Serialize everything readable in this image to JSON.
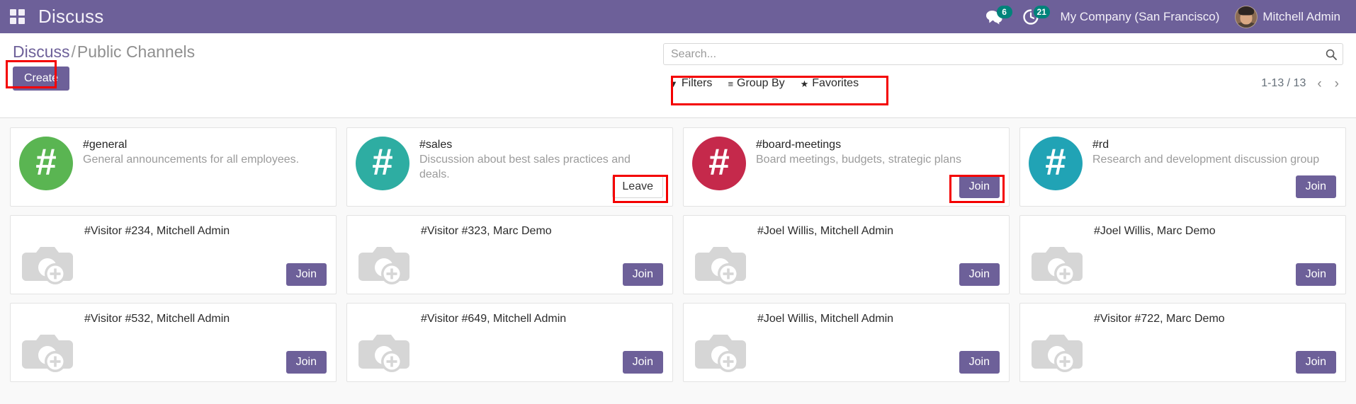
{
  "navbar": {
    "apps_icon": "apps-grid-icon",
    "app_title": "Discuss",
    "messages_icon": "messages-icon",
    "messages_count": "6",
    "activities_icon": "clock-activity-icon",
    "activities_count": "21",
    "company": "My Company (San Francisco)",
    "user_name": "Mitchell Admin",
    "avatar_icon": "user-avatar",
    "brand_color": "#6d6099",
    "badge_color": "#00837a"
  },
  "control_panel": {
    "breadcrumb_root": "Discuss",
    "breadcrumb_separator": "/",
    "breadcrumb_current": "Public Channels",
    "create_label": "Create",
    "search_placeholder": "Search...",
    "search_value": "",
    "search_icon": "search-icon",
    "filters": [
      {
        "label": "Filters",
        "icon": "filter-funnel-icon",
        "glyph": "▼"
      },
      {
        "label": "Group By",
        "icon": "group-by-lines-icon",
        "glyph": "≡"
      },
      {
        "label": "Favorites",
        "icon": "star-icon",
        "glyph": "★"
      }
    ],
    "pager_count": "1-13 / 13",
    "pager_prev_icon": "chevron-left-icon",
    "pager_prev_glyph": "‹",
    "pager_next_icon": "chevron-right-icon",
    "pager_next_glyph": "›"
  },
  "annotations": {
    "color": "#f40000",
    "boxes": [
      "create-button",
      "filters-group",
      "sales-leave-button",
      "board-meetings-join-button"
    ]
  },
  "kanban": {
    "hash_glyph": "#",
    "cards": [
      {
        "kind": "channel",
        "title": "#general",
        "description": "General announcements for all employees.",
        "avatar_color": "#5ab552",
        "avatar_icon": "hash-avatar",
        "action_label": "",
        "action_style": "none",
        "action_name": ""
      },
      {
        "kind": "channel",
        "title": "#sales",
        "description": "Discussion about best sales practices and deals.",
        "avatar_color": "#2eada2",
        "avatar_icon": "hash-avatar",
        "action_label": "Leave",
        "action_style": "secondary",
        "action_name": "leave-button"
      },
      {
        "kind": "channel",
        "title": "#board-meetings",
        "description": "Board meetings, budgets, strategic plans",
        "avatar_color": "#c5294b",
        "avatar_icon": "hash-avatar",
        "action_label": "Join",
        "action_style": "primary",
        "action_name": "join-button"
      },
      {
        "kind": "channel",
        "title": "#rd",
        "description": "Research and development discussion group",
        "avatar_color": "#21a3b5",
        "avatar_icon": "hash-avatar",
        "action_label": "Join",
        "action_style": "primary",
        "action_name": "join-button"
      },
      {
        "kind": "chat",
        "title": "#Visitor #234, Mitchell Admin",
        "description": "",
        "avatar_icon": "camera-placeholder-icon",
        "action_label": "Join",
        "action_style": "primary",
        "action_name": "join-button"
      },
      {
        "kind": "chat",
        "title": "#Visitor #323, Marc Demo",
        "description": "",
        "avatar_icon": "camera-placeholder-icon",
        "action_label": "Join",
        "action_style": "primary",
        "action_name": "join-button"
      },
      {
        "kind": "chat",
        "title": "#Joel Willis, Mitchell Admin",
        "description": "",
        "avatar_icon": "camera-placeholder-icon",
        "action_label": "Join",
        "action_style": "primary",
        "action_name": "join-button"
      },
      {
        "kind": "chat",
        "title": "#Joel Willis, Marc Demo",
        "description": "",
        "avatar_icon": "camera-placeholder-icon",
        "action_label": "Join",
        "action_style": "primary",
        "action_name": "join-button"
      },
      {
        "kind": "chat",
        "title": "#Visitor #532, Mitchell Admin",
        "description": "",
        "avatar_icon": "camera-placeholder-icon",
        "action_label": "Join",
        "action_style": "primary",
        "action_name": "join-button"
      },
      {
        "kind": "chat",
        "title": "#Visitor #649, Mitchell Admin",
        "description": "",
        "avatar_icon": "camera-placeholder-icon",
        "action_label": "Join",
        "action_style": "primary",
        "action_name": "join-button"
      },
      {
        "kind": "chat",
        "title": "#Joel Willis, Mitchell Admin",
        "description": "",
        "avatar_icon": "camera-placeholder-icon",
        "action_label": "Join",
        "action_style": "primary",
        "action_name": "join-button"
      },
      {
        "kind": "chat",
        "title": "#Visitor #722, Marc Demo",
        "description": "",
        "avatar_icon": "camera-placeholder-icon",
        "action_label": "Join",
        "action_style": "primary",
        "action_name": "join-button"
      }
    ]
  }
}
